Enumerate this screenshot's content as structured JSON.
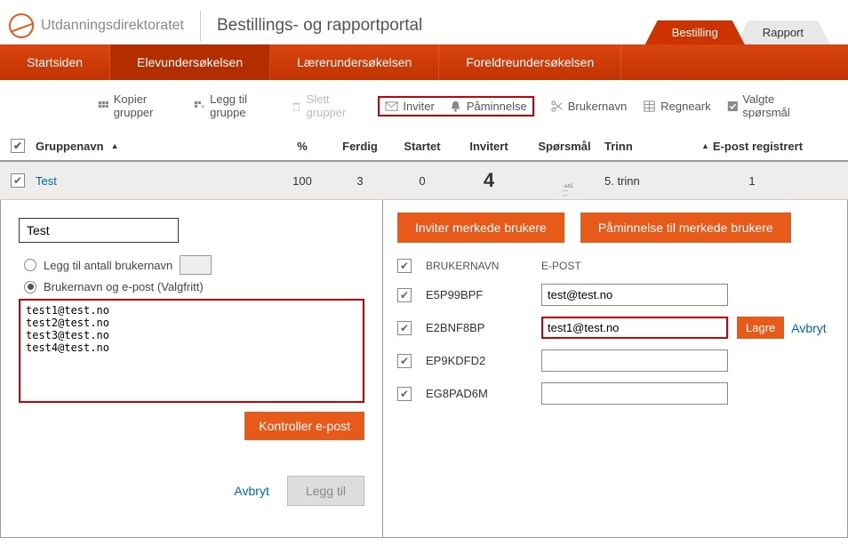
{
  "header": {
    "brand": "Utdanningsdirektoratet",
    "portal_title": "Bestillings- og rapportportal",
    "tabs": {
      "bestilling": "Bestilling",
      "rapport": "Rapport"
    }
  },
  "nav": {
    "startsiden": "Startsiden",
    "elev": "Elevundersøkelsen",
    "laerer": "Lærerundersøkelsen",
    "foreldre": "Foreldreundersøkelsen"
  },
  "toolbar": {
    "kopier": "Kopier grupper",
    "legg_til": "Legg til gruppe",
    "slett": "Slett grupper",
    "inviter": "Inviter",
    "paminnelse": "Påminnelse",
    "brukernavn": "Brukernavn",
    "regneark": "Regneark",
    "valgte": "Valgte spørsmål"
  },
  "columns": {
    "gruppenavn": "Gruppenavn",
    "pct": "%",
    "ferdig": "Ferdig",
    "startet": "Startet",
    "invitert": "Invitert",
    "sporsmal": "Spørsmål",
    "trinn": "Trinn",
    "epost_reg": "E-post registrert"
  },
  "row": {
    "name": "Test",
    "pct": "100",
    "ferdig": "3",
    "startet": "0",
    "invitert": "4",
    "trinn": "5. trinn",
    "epost_reg": "1"
  },
  "left": {
    "name_value": "Test",
    "radio_antall_label": "Legg til antall brukernavn",
    "radio_epost_label": "Brukernavn og e-post (Valgfritt)",
    "emails_text": "test1@test.no\ntest2@test.no\ntest3@test.no\ntest4@test.no",
    "kontroller": "Kontroller e-post",
    "avbryt": "Avbryt",
    "legg_til": "Legg til"
  },
  "right": {
    "inviter_btn": "Inviter merkede brukere",
    "paminnelse_btn": "Påminnelse til merkede brukere",
    "col_brukernavn": "BRUKERNAVN",
    "col_epost": "E-POST",
    "lagre": "Lagre",
    "avbryt": "Avbryt",
    "users": [
      {
        "uname": "E5P99BPF",
        "email": "test@test.no",
        "editing": false
      },
      {
        "uname": "E2BNF8BP",
        "email": "test1@test.no",
        "editing": true
      },
      {
        "uname": "EP9KDFD2",
        "email": "",
        "editing": false
      },
      {
        "uname": "EG8PAD6M",
        "email": "",
        "editing": false
      }
    ]
  }
}
